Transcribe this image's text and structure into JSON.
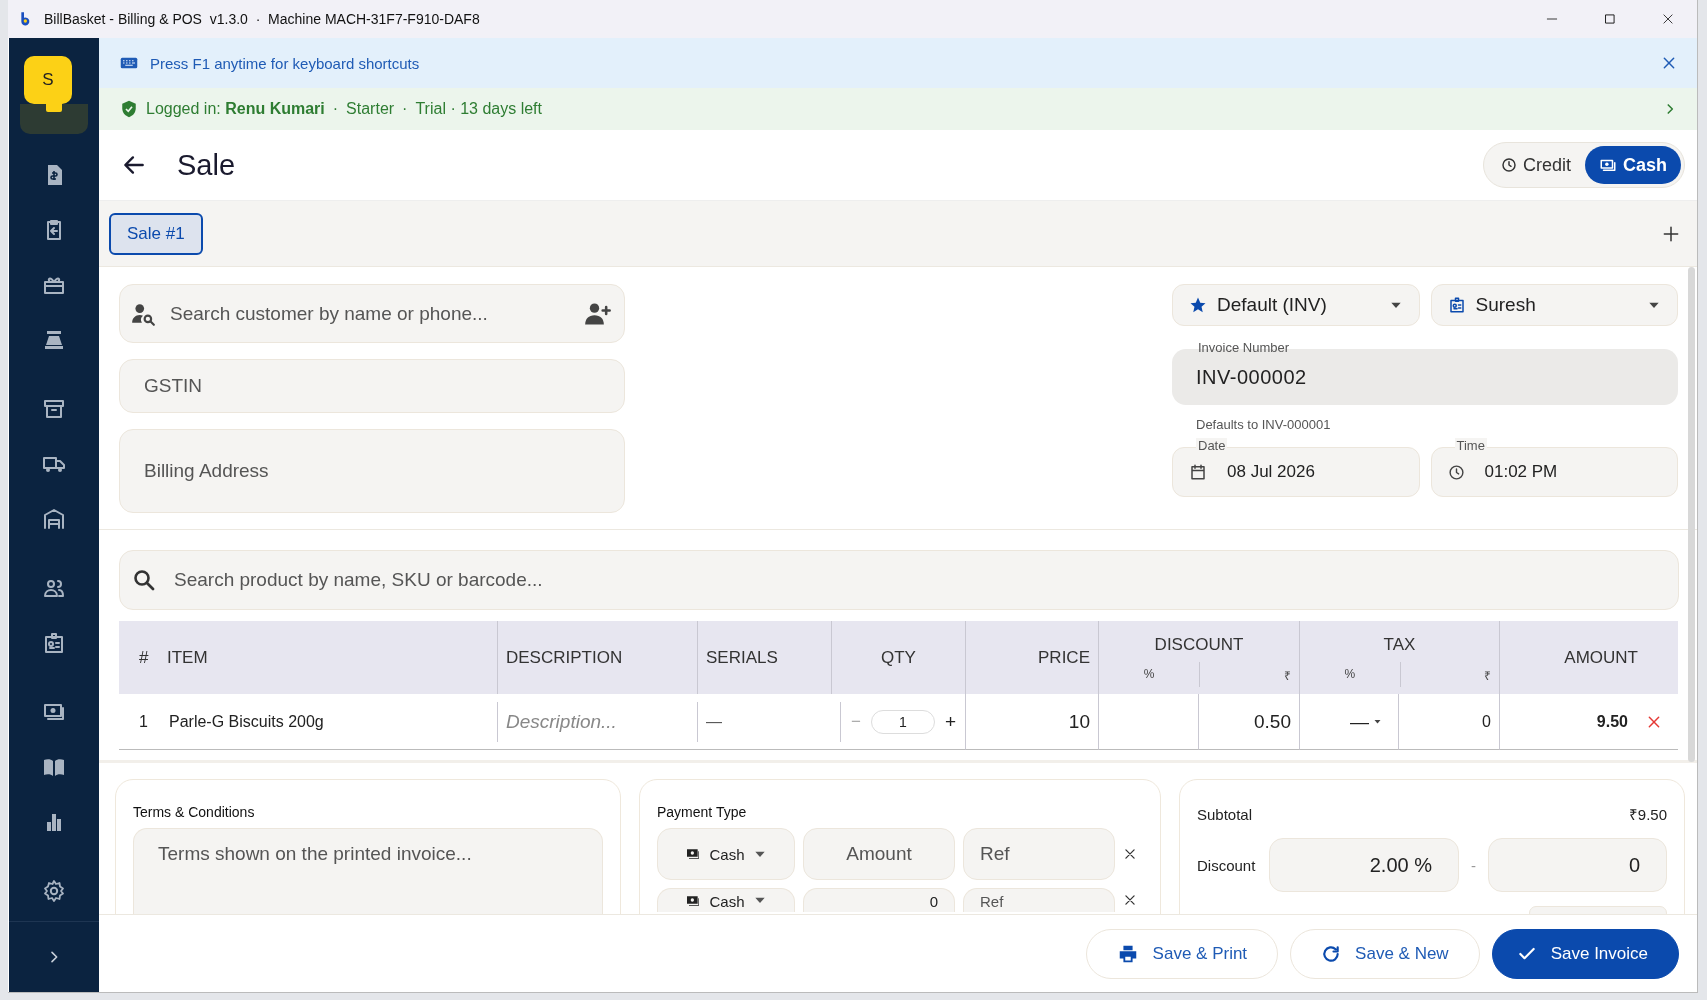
{
  "window": {
    "title": "BillBasket - Billing & POS  v1.3.0  ·  Machine MACH-31F7-F910-DAF8"
  },
  "sidebar": {
    "avatar": "S",
    "items": [
      {
        "selected": true
      },
      {
        "selected": false
      },
      {
        "selected": false
      },
      {
        "selected": false
      },
      {
        "selected": false
      },
      {
        "selected": false
      },
      {
        "selected": false
      },
      {
        "selected": false
      },
      {
        "selected": false
      },
      {
        "selected": false
      },
      {
        "selected": false
      },
      {
        "selected": false
      },
      {
        "selected": false
      },
      {
        "selected": false
      }
    ]
  },
  "shortcut_banner": {
    "text": "Press F1 anytime for keyboard shortcuts"
  },
  "login_banner": {
    "label": "Logged in:",
    "user": "Renu Kumari",
    "sep_1": "·",
    "plan": "Starter",
    "sep_2": "·",
    "trial": "Trial · 13 days left"
  },
  "header": {
    "title": "Sale",
    "modes": [
      {
        "label": "Credit",
        "kind": "credit",
        "selected": false
      },
      {
        "label": "Cash",
        "kind": "cash",
        "selected": true
      }
    ]
  },
  "sale_tabs": [
    {
      "label": "Sale #1",
      "selected": true
    }
  ],
  "customer": {
    "search_placeholder": "Search customer by name or phone...",
    "gstin_placeholder": "GSTIN",
    "address_placeholder": "Billing Address"
  },
  "invoice": {
    "series": "Default (INV)",
    "staff": "Suresh",
    "number_label": "Invoice Number",
    "number": "INV-000002",
    "number_hint": "Defaults to INV-000001",
    "date_label": "Date",
    "date": "08 Jul 2026",
    "time_label": "Time",
    "time": "01:02 PM"
  },
  "product_search": {
    "placeholder": "Search product by name, SKU or barcode..."
  },
  "table": {
    "columns": [
      "#",
      "ITEM",
      "DESCRIPTION",
      "SERIALS",
      "QTY",
      "PRICE"
    ],
    "discount": {
      "label": "DISCOUNT",
      "sub": [
        "%",
        "₹"
      ]
    },
    "tax": {
      "label": "TAX",
      "sub": [
        "%",
        "₹"
      ]
    },
    "amount_label": "AMOUNT",
    "rows": [
      {
        "index": "1",
        "item": "Parle-G Biscuits 200g",
        "description_placeholder": "Description...",
        "serials": "—",
        "qty_minus": "−",
        "qty": "1",
        "qty_plus": "+",
        "price": "10",
        "discount_percent": "",
        "discount_amount": "0.50",
        "tax_percent": "—",
        "tax_amount": "0",
        "amount": "9.50"
      }
    ]
  },
  "terms": {
    "title": "Terms & Conditions",
    "placeholder": "Terms shown on the printed invoice..."
  },
  "payment": {
    "title": "Payment Type",
    "rows": [
      {
        "method": "Cash",
        "amount_placeholder": "Amount",
        "ref_placeholder": "Ref"
      },
      {
        "method": "Cash",
        "amount": "0",
        "ref_placeholder": "Ref"
      }
    ]
  },
  "summary": {
    "subtotal_label": "Subtotal",
    "subtotal": "₹9.50",
    "discount_label": "Discount",
    "discount_percent": "2.00",
    "percent_sign": "%",
    "discount_separator": "-",
    "discount_amount": "0"
  },
  "footer": {
    "buttons": [
      {
        "label": "Save & Print",
        "kind": "print"
      },
      {
        "label": "Save & New",
        "kind": "new"
      },
      {
        "label": "Save Invoice",
        "kind": "primary"
      }
    ]
  }
}
